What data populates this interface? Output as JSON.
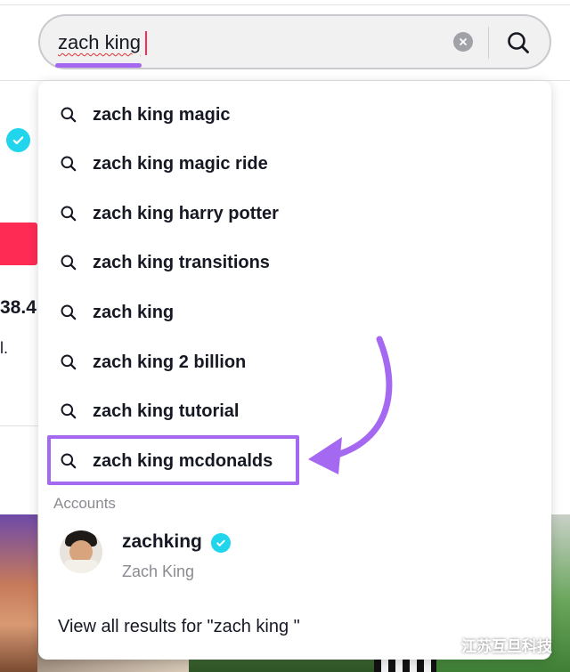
{
  "search": {
    "query": "zach king",
    "clear_icon": "clear-icon",
    "search_icon": "search-icon"
  },
  "suggestions": [
    "zach king magic",
    "zach king magic ride",
    "zach king harry potter",
    "zach king transitions",
    "zach king",
    "zach king 2 billion",
    "zach king tutorial",
    "zach king mcdonalds"
  ],
  "highlighted_suggestion_index": 7,
  "accounts": {
    "heading": "Accounts",
    "items": [
      {
        "username": "zachking",
        "display_name": "Zach King",
        "verified": true
      }
    ]
  },
  "view_all_label": "View all results for \"zach king \"",
  "background": {
    "follow_count_fragment": "38.4",
    "bio_fragment": "l."
  },
  "watermark": {
    "text": "江苏互旦科技",
    "icon": "wechat-logo"
  },
  "colors": {
    "accent_purple": "#a569f1",
    "verified_cyan": "#20d5ec",
    "brand_red": "#fe2c55",
    "text_primary": "#161823",
    "text_secondary": "#8a8b91"
  }
}
